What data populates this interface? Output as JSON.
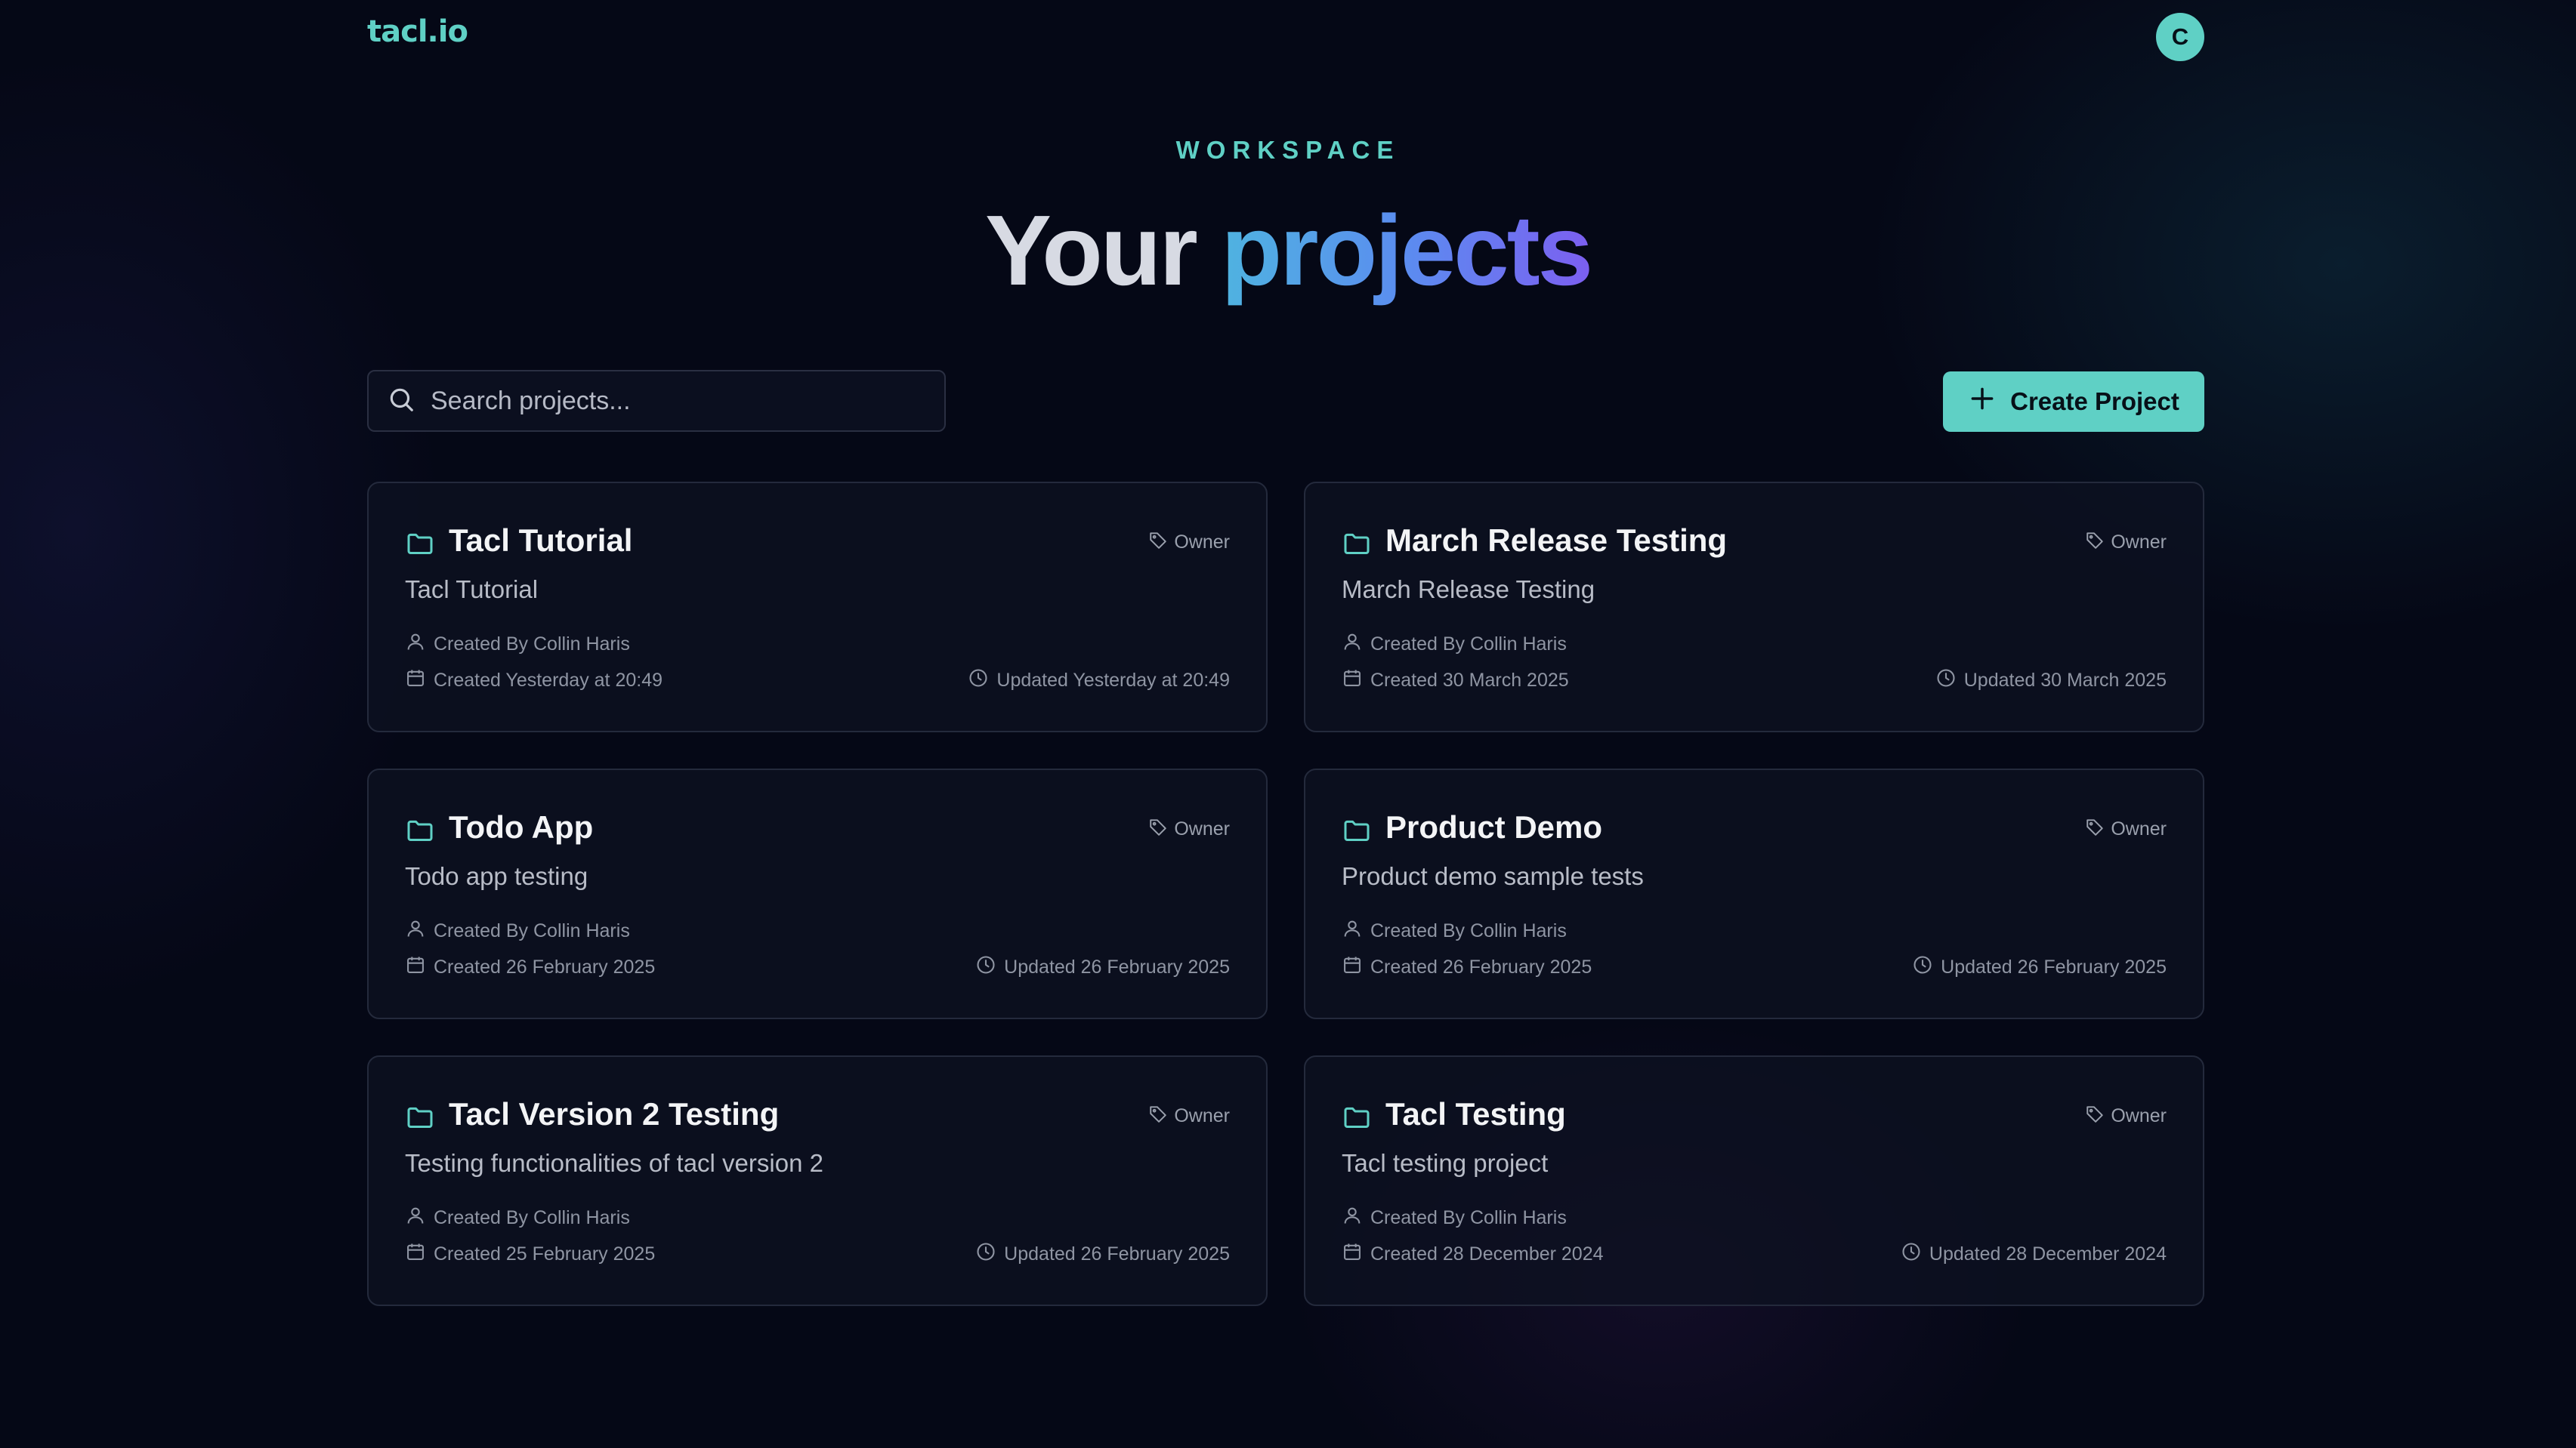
{
  "app": {
    "logo": "tacl.io",
    "avatar_initial": "C"
  },
  "hero": {
    "eyebrow": "WORKSPACE",
    "title_part1": "Your",
    "title_part2": "projects"
  },
  "search": {
    "placeholder": "Search projects...",
    "value": ""
  },
  "actions": {
    "create_label": "Create Project"
  },
  "colors": {
    "accent": "#5fd0c5",
    "background": "#050816",
    "gradient_start": "#4fb3e0",
    "gradient_end": "#7c5ff0"
  },
  "icons": {
    "logo": "tacl-logo",
    "search": "search-icon",
    "create": "plus-icon",
    "project": "folder-icon",
    "role": "tag-icon",
    "creator": "user-icon",
    "created": "calendar-icon",
    "updated": "clock-icon"
  },
  "projects": [
    {
      "name": "Tacl Tutorial",
      "description": "Tacl Tutorial",
      "role": "Owner",
      "created_by": "Created By Collin Haris",
      "created": "Created Yesterday at 20:49",
      "updated": "Updated Yesterday at 20:49"
    },
    {
      "name": "March Release Testing",
      "description": "March Release Testing",
      "role": "Owner",
      "created_by": "Created By Collin Haris",
      "created": "Created 30 March 2025",
      "updated": "Updated 30 March 2025"
    },
    {
      "name": "Todo App",
      "description": "Todo app testing",
      "role": "Owner",
      "created_by": "Created By Collin Haris",
      "created": "Created 26 February 2025",
      "updated": "Updated 26 February 2025"
    },
    {
      "name": "Product Demo",
      "description": "Product demo sample tests",
      "role": "Owner",
      "created_by": "Created By Collin Haris",
      "created": "Created 26 February 2025",
      "updated": "Updated 26 February 2025"
    },
    {
      "name": "Tacl Version 2 Testing",
      "description": "Testing functionalities of tacl version 2",
      "role": "Owner",
      "created_by": "Created By Collin Haris",
      "created": "Created 25 February 2025",
      "updated": "Updated 26 February 2025"
    },
    {
      "name": "Tacl Testing",
      "description": "Tacl testing project",
      "role": "Owner",
      "created_by": "Created By Collin Haris",
      "created": "Created 28 December 2024",
      "updated": "Updated 28 December 2024"
    }
  ]
}
